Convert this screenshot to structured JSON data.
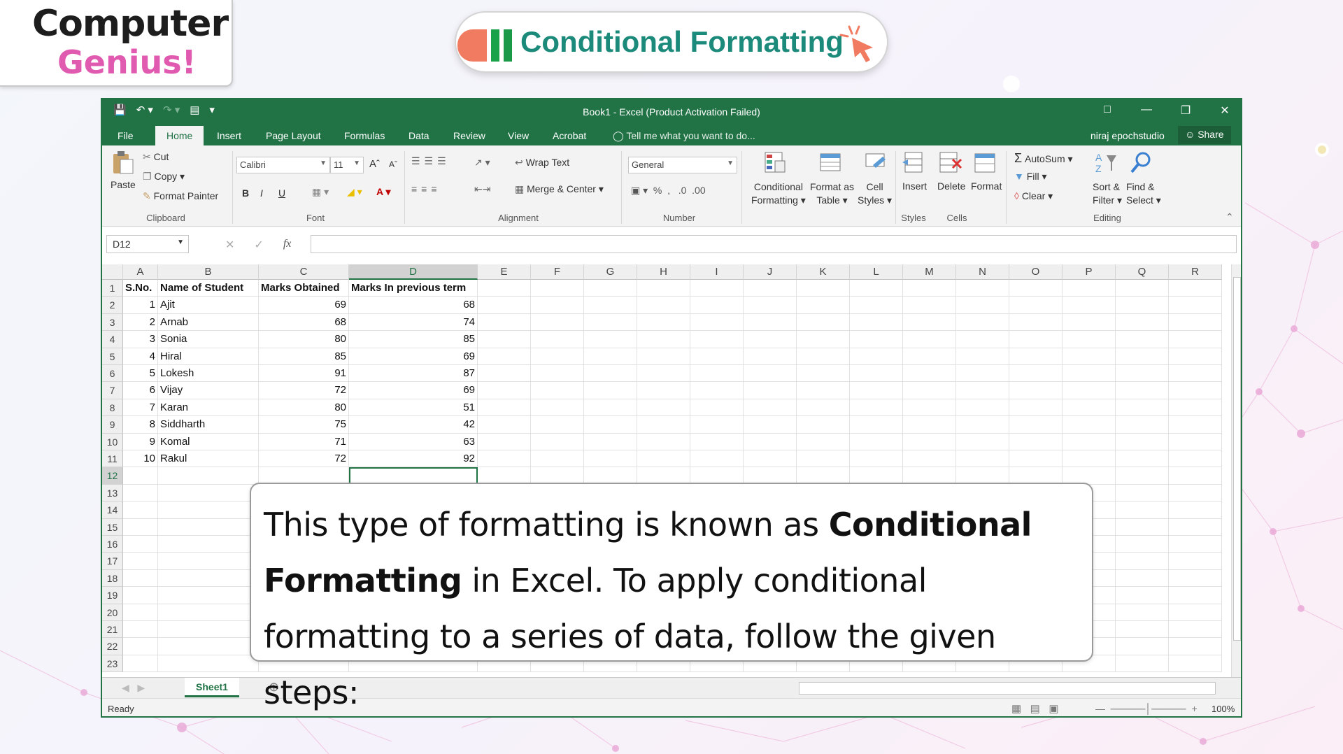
{
  "brand": {
    "line1": "Computer",
    "line2": "Genius!"
  },
  "slide_title": "Conditional Formatting",
  "window": {
    "title": "Book1 - Excel (Product Activation Failed)",
    "tabs": [
      "File",
      "Home",
      "Insert",
      "Page Layout",
      "Formulas",
      "Data",
      "Review",
      "View",
      "Acrobat"
    ],
    "active_tab": "Home",
    "tell_me": "Tell me what you want to do...",
    "user": "niraj epochstudio",
    "share": "Share"
  },
  "ribbon": {
    "clipboard": {
      "paste": "Paste",
      "cut": "Cut",
      "copy": "Copy",
      "format_painter": "Format Painter",
      "label": "Clipboard"
    },
    "font": {
      "name": "Calibri",
      "size": "11",
      "bold": "B",
      "italic": "I",
      "underline": "U",
      "label": "Font"
    },
    "alignment": {
      "wrap_text": "Wrap Text",
      "merge_center": "Merge & Center",
      "label": "Alignment"
    },
    "number": {
      "format": "General",
      "label": "Number"
    },
    "styles": {
      "conditional_formatting": "Conditional\nFormatting",
      "cf1": "Conditional",
      "cf2": "Formatting",
      "fat1": "Format as",
      "fat2": "Table",
      "cs1": "Cell",
      "cs2": "Styles",
      "label": "Styles"
    },
    "cells": {
      "insert": "Insert",
      "delete": "Delete",
      "format": "Format",
      "label": "Cells"
    },
    "editing": {
      "autosum": "AutoSum",
      "fill": "Fill",
      "clear": "Clear",
      "sort1": "Sort &",
      "sort2": "Filter",
      "find1": "Find &",
      "find2": "Select",
      "label": "Editing"
    }
  },
  "formula_bar": {
    "name_box": "D12",
    "fx": "fx",
    "value": ""
  },
  "columns": [
    "A",
    "B",
    "C",
    "D",
    "E",
    "F",
    "G",
    "H",
    "I",
    "J",
    "K",
    "L",
    "M",
    "N",
    "O",
    "P",
    "Q",
    "R"
  ],
  "selected_column": "D",
  "rows": [
    "1",
    "2",
    "3",
    "4",
    "5",
    "6",
    "7",
    "8",
    "9",
    "10",
    "11",
    "12",
    "13",
    "14",
    "15",
    "16",
    "17",
    "18",
    "19",
    "20",
    "21",
    "22",
    "23"
  ],
  "selected_row": "12",
  "table": {
    "headers": [
      "S.No.",
      "Name of Student",
      "Marks Obtained",
      "Marks In previous term"
    ],
    "records": [
      [
        "1",
        "Ajit",
        "69",
        "68"
      ],
      [
        "2",
        "Arnab",
        "68",
        "74"
      ],
      [
        "3",
        "Sonia",
        "80",
        "85"
      ],
      [
        "4",
        "Hiral",
        "85",
        "69"
      ],
      [
        "5",
        "Lokesh",
        "91",
        "87"
      ],
      [
        "6",
        "Vijay",
        "72",
        "69"
      ],
      [
        "7",
        "Karan",
        "80",
        "51"
      ],
      [
        "8",
        "Siddharth",
        "75",
        "42"
      ],
      [
        "9",
        "Komal",
        "71",
        "63"
      ],
      [
        "10",
        "Rakul",
        "72",
        "92"
      ]
    ]
  },
  "sheet_tab": "Sheet1",
  "status": {
    "ready": "Ready",
    "zoom": "100%"
  },
  "callout": {
    "part1": "This type of formatting is known as ",
    "bold1": "Conditional Formatting",
    "part2": " in Excel. To apply conditional formatting to a series of data, follow the given steps:"
  },
  "colors": {
    "excel_green": "#217346",
    "title_teal": "#1c8a7a",
    "brand_pink": "#e05ab0"
  }
}
